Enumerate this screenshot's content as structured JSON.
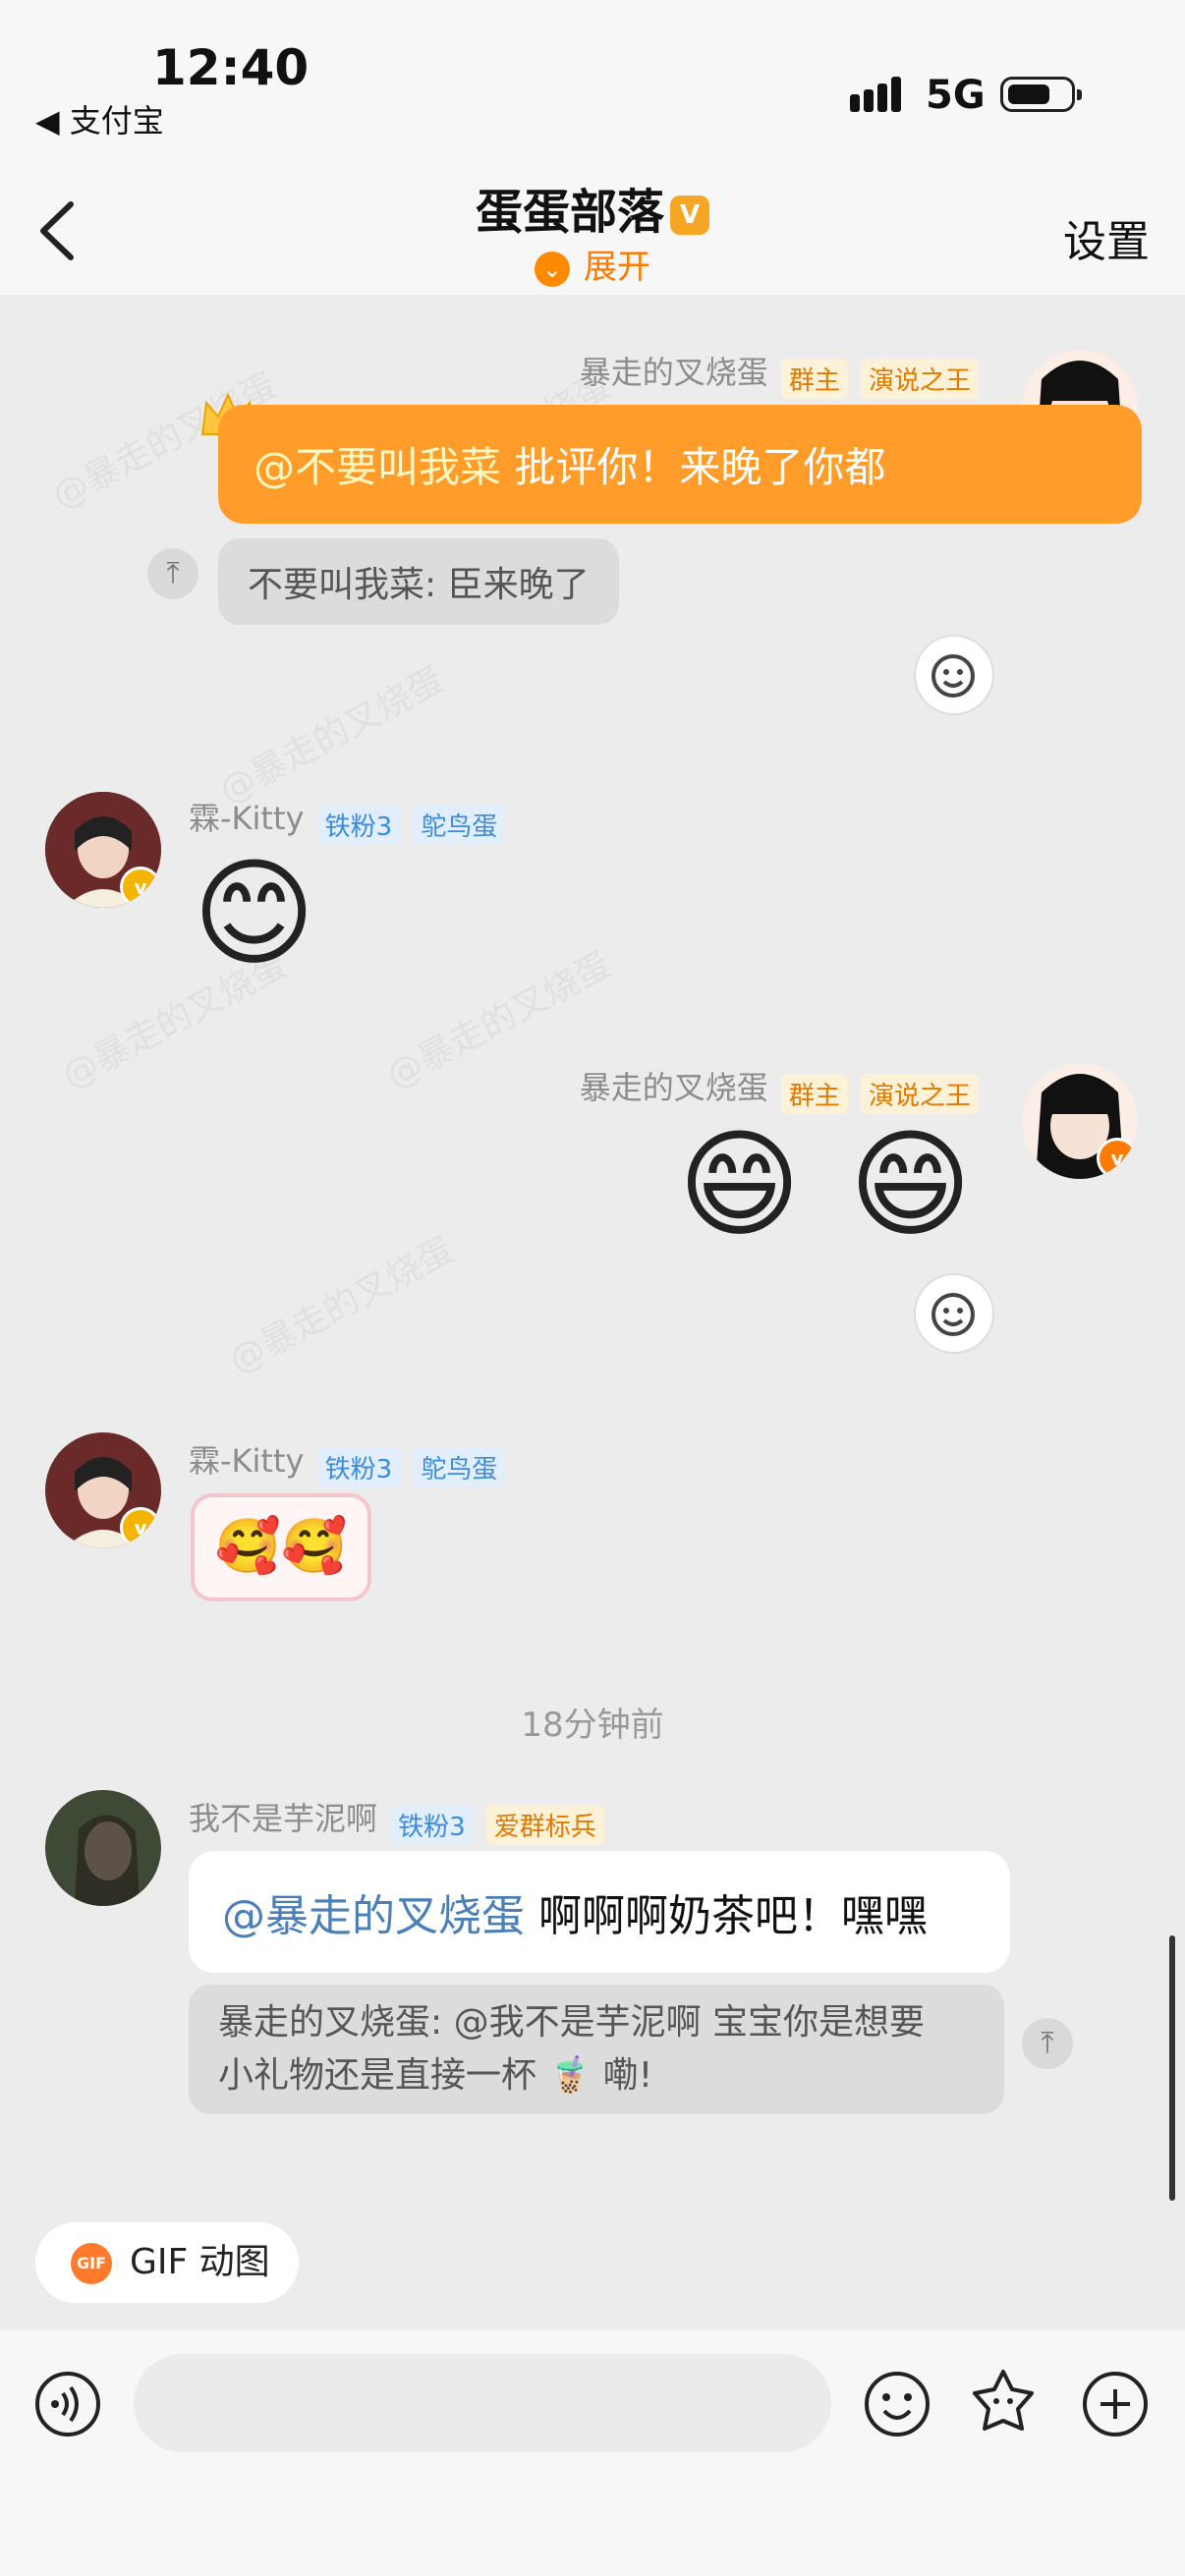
{
  "status_bar": {
    "time": "12:40",
    "back_app": "◀ 支付宝",
    "network": "5G"
  },
  "header": {
    "title": "蛋蛋部落",
    "title_badge": "V",
    "expand_label": "展开",
    "settings_label": "设置"
  },
  "watermark_text": "@暴走的叉烧蛋",
  "messages": [
    {
      "sender": "暴走的叉烧蛋",
      "tags": [
        "群主",
        "演说之王"
      ],
      "mention": "@不要叫我菜",
      "text": " 批评你！来晚了你都",
      "quote": "不要叫我菜: 臣来晚了"
    },
    {
      "sender": "霖-Kitty",
      "tags": [
        "铁粉3",
        "鸵鸟蛋"
      ],
      "emoji": "😊"
    },
    {
      "sender": "暴走的叉烧蛋",
      "tags": [
        "群主",
        "演说之王"
      ],
      "emoji": [
        "😄",
        "😄"
      ]
    },
    {
      "sender": "霖-Kitty",
      "tags": [
        "铁粉3",
        "鸵鸟蛋"
      ],
      "sticker": "🥰🥰"
    },
    {
      "sender": "我不是芋泥啊",
      "tags": [
        "铁粉3",
        "爱群标兵"
      ],
      "mention": "@暴走的叉烧蛋",
      "text": " 啊啊啊奶茶吧！嘿嘿",
      "quote_line1": "暴走的叉烧蛋: @我不是芋泥啊 宝宝你是想要",
      "quote_line2": "小礼物还是直接一杯 🧋 嘞!"
    }
  ],
  "timestamp": "18分钟前",
  "gif_button": {
    "badge": "GIF",
    "label": "GIF 动图"
  },
  "icons": {
    "voice": "voice-icon",
    "emoji": "emoji-icon",
    "sticker": "sticker-icon",
    "plus": "plus-icon",
    "react": "add-reaction-icon",
    "pin": "pin-top-icon"
  },
  "colors": {
    "accent": "#ff9c2a",
    "tag_orange": "#e07a00",
    "tag_blue": "#3b8be0"
  }
}
